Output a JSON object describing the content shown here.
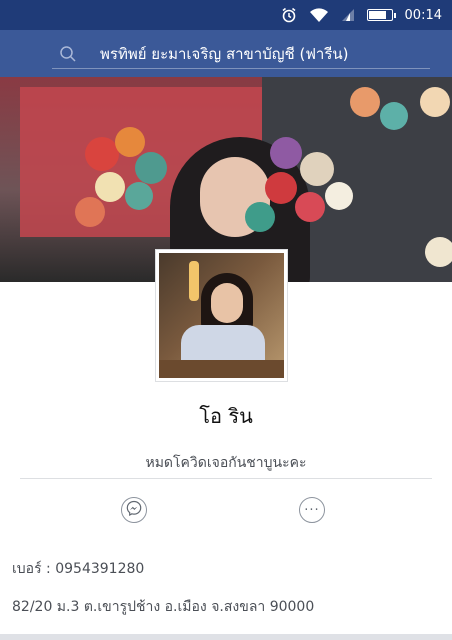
{
  "status_bar": {
    "time": "00:14",
    "icons": [
      "alarm-icon",
      "wifi-icon",
      "signal-icon",
      "battery-icon"
    ],
    "battery_level": 0.85
  },
  "search": {
    "query": "พรทิพย์ ยะมาเจริญ   สาขาบัญชี   (ฟารีน)"
  },
  "profile": {
    "name": "โอ ริน",
    "bio": "หมดโควิดเจอกันชาบูนะคะ"
  },
  "actions": {
    "messenger_icon": "messenger-icon",
    "more_icon": "more-icon",
    "more_glyph": "···"
  },
  "info": {
    "phone": "เบอร์ : 0954391280",
    "address": "82/20 ม.3 ต.เขารูปช้าง อ.เมือง จ.สงขลา 90000"
  },
  "colors": {
    "status_bar": "#1f3b78",
    "header": "#3b5998"
  }
}
